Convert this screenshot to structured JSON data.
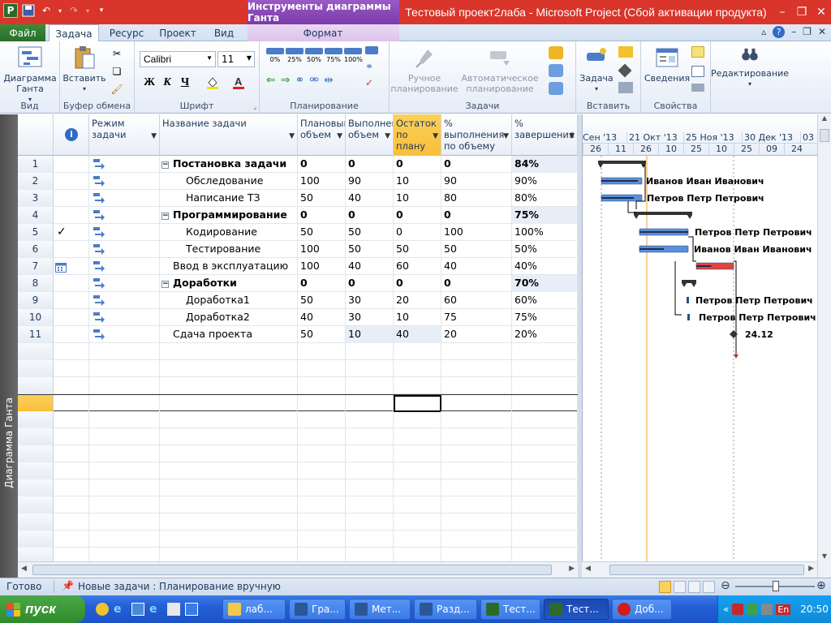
{
  "window": {
    "context_tab_header": "Инструменты диаграммы Ганта",
    "title": "Тестовый проект2лаба  -  Microsoft Project (Сбой активации продукта)"
  },
  "ribbon_tabs": {
    "file": "Файл",
    "task": "Задача",
    "resource": "Ресурс",
    "project": "Проект",
    "view": "Вид",
    "format": "Формат"
  },
  "ribbon": {
    "view_group": {
      "button": "Диаграмма Ганта",
      "label": "Вид"
    },
    "clipboard_group": {
      "paste": "Вставить",
      "label": "Буфер обмена"
    },
    "font_group": {
      "font_name": "Calibri",
      "font_size": "11",
      "bold": "Ж",
      "italic": "К",
      "underline": "Ч",
      "label": "Шрифт"
    },
    "schedule_group": {
      "pct": [
        "0%",
        "25%",
        "50%",
        "75%",
        "100%"
      ],
      "label": "Планирование"
    },
    "tasks_group": {
      "manual": "Ручное планирование",
      "auto": "Автоматическое планирование",
      "label": "Задачи"
    },
    "insert_group": {
      "task": "Задача",
      "label": "Вставить"
    },
    "properties_group": {
      "info": "Сведения",
      "label": "Свойства"
    },
    "editing_group": {
      "label": "Редактирование"
    }
  },
  "sidebar": {
    "view_name": "Диаграмма Ганта"
  },
  "grid": {
    "columns": {
      "mode": "Режим задачи",
      "name": "Название задачи",
      "planned": "Плановый объем",
      "done": "Выполненный объем",
      "remaining": "Остаток по плану",
      "pct_work": "% выполнения по объему",
      "pct_complete": "% завершения"
    },
    "rows": [
      {
        "id": "1",
        "name": "Постановка задачи",
        "planned": "0",
        "done": "0",
        "remaining": "0",
        "pct_work": "0",
        "pct_complete": "84%"
      },
      {
        "id": "2",
        "name": "Обследование",
        "planned": "100",
        "done": "90",
        "remaining": "10",
        "pct_work": "90",
        "pct_complete": "90%"
      },
      {
        "id": "3",
        "name": "Написание ТЗ",
        "planned": "50",
        "done": "40",
        "remaining": "10",
        "pct_work": "80",
        "pct_complete": "80%"
      },
      {
        "id": "4",
        "name": "Программирование",
        "planned": "0",
        "done": "0",
        "remaining": "0",
        "pct_work": "0",
        "pct_complete": "75%"
      },
      {
        "id": "5",
        "name": "Кодирование",
        "planned": "50",
        "done": "50",
        "remaining": "0",
        "pct_work": "100",
        "pct_complete": "100%"
      },
      {
        "id": "6",
        "name": "Тестирование",
        "planned": "100",
        "done": "50",
        "remaining": "50",
        "pct_work": "50",
        "pct_complete": "50%"
      },
      {
        "id": "7",
        "name": "Ввод в эксплуатацию",
        "planned": "100",
        "done": "40",
        "remaining": "60",
        "pct_work": "40",
        "pct_complete": "40%"
      },
      {
        "id": "8",
        "name": "Доработки",
        "planned": "0",
        "done": "0",
        "remaining": "0",
        "pct_work": "0",
        "pct_complete": "70%"
      },
      {
        "id": "9",
        "name": "Доработка1",
        "planned": "50",
        "done": "30",
        "remaining": "20",
        "pct_work": "60",
        "pct_complete": "60%"
      },
      {
        "id": "10",
        "name": "Доработка2",
        "planned": "40",
        "done": "30",
        "remaining": "10",
        "pct_work": "75",
        "pct_complete": "75%"
      },
      {
        "id": "11",
        "name": "Сдача проекта",
        "planned": "50",
        "done": "10",
        "remaining": "40",
        "pct_work": "20",
        "pct_complete": "20%"
      }
    ]
  },
  "gantt": {
    "months": [
      "Сен '13",
      "21 Окт '13",
      "25 Ноя '13",
      "30 Дек '13",
      "03"
    ],
    "days": [
      "26",
      "11",
      "26",
      "10",
      "25",
      "10",
      "25",
      "09",
      "24"
    ],
    "labels": {
      "r2": "Иванов Иван Иванович",
      "r3": "Петров Петр Петрович",
      "r5": "Петров Петр Петрович",
      "r6": "Иванов Иван Иванович",
      "r9": "Петров Петр Петрович",
      "r10": "Петров Петр Петрович",
      "r11": "24.12"
    }
  },
  "statusbar": {
    "ready": "Готово",
    "new_tasks": "Новые задачи : Планирование вручную"
  },
  "taskbar": {
    "start": "пуск",
    "buttons": [
      "лаб...",
      "Гра...",
      "Мет...",
      "Разд...",
      "Тест...",
      "Тест...",
      "Доб..."
    ],
    "lang": "En",
    "time": "20:50"
  }
}
